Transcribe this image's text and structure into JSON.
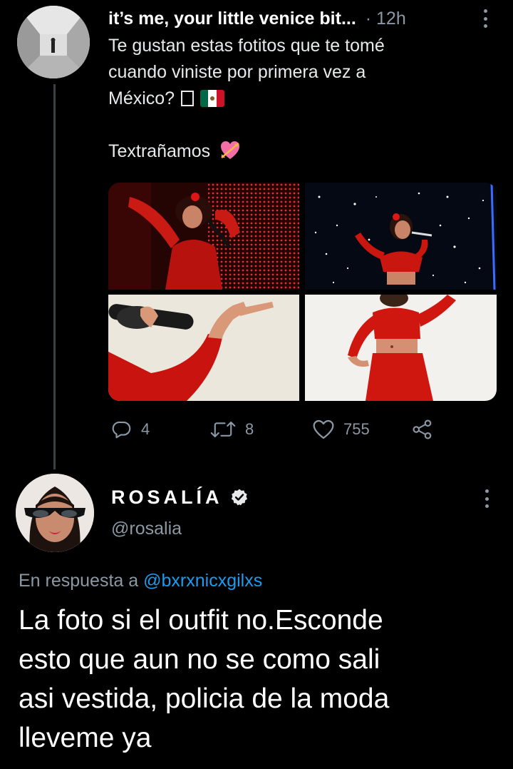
{
  "tweet": {
    "author_name": "it’s me, your little venice bit...",
    "time": "· 12h",
    "lines": [
      "Te gustan estas fotitos que te tomé",
      "cuando viniste por primera vez a",
      "México?",
      "",
      "Textrañamos"
    ],
    "emoji_icons": [
      "missing-glyph-box",
      "mexico-flag-icon",
      "heart-with-arrow-icon"
    ],
    "stats": {
      "replies": "4",
      "retweets": "8",
      "likes": "755"
    }
  },
  "reply": {
    "author_name": "ROSALÍA",
    "handle": "@rosalia",
    "replying_prefix": "En respuesta a",
    "replying_to": "@bxrxnicxgilxs",
    "lines": [
      "La foto si el outfit no.Esconde",
      "esto que aun no se como sali",
      "asi vestida, policia de la moda",
      "lleveme ya"
    ]
  },
  "colors": {
    "background": "#000000",
    "text": "#e7e9ea",
    "secondary_text": "#8b98a5",
    "link": "#1d9bf0",
    "thread_line": "#3e4144"
  }
}
